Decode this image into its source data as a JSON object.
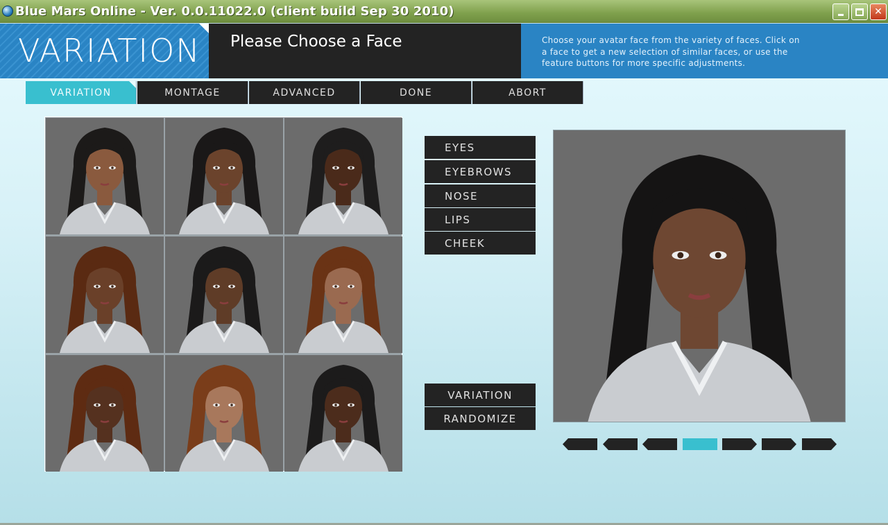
{
  "window": {
    "title": "Blue Mars Online - Ver. 0.0.11022.0 (client build Sep 30 2010)",
    "app_icon": "globe-icon",
    "controls": [
      "minimize-icon",
      "maximize-icon",
      "close-icon"
    ]
  },
  "header": {
    "brand": "VARIATION",
    "heading": "Please Choose a Face",
    "description": "Choose your avatar face from the variety of faces.  Click on a face to get a new selection of similar faces, or use the feature buttons for more specific adjustments."
  },
  "tabs": [
    {
      "label": "VARIATION",
      "active": true
    },
    {
      "label": "MONTAGE",
      "active": false
    },
    {
      "label": "ADVANCED",
      "active": false
    },
    {
      "label": "DONE",
      "active": false
    },
    {
      "label": "ABORT",
      "active": false
    }
  ],
  "features": [
    "EYES",
    "EYEBROWS",
    "NOSE",
    "LIPS",
    "CHEEK"
  ],
  "actions": [
    "VARIATION",
    "RANDOMIZE"
  ],
  "faces": [
    {
      "skin": "#8a5a3e",
      "hair": "#1c1a19"
    },
    {
      "skin": "#6b432c",
      "hair": "#1a1818"
    },
    {
      "skin": "#4a2a1a",
      "hair": "#1e1d1d"
    },
    {
      "skin": "#6a4029",
      "hair": "#5a2a12"
    },
    {
      "skin": "#5f3c27",
      "hair": "#1b1a1a"
    },
    {
      "skin": "#9a6a50",
      "hair": "#6a3315"
    },
    {
      "skin": "#55311f",
      "hair": "#5e2b12"
    },
    {
      "skin": "#a8785c",
      "hair": "#7a3d1a"
    },
    {
      "skin": "#4c2c1c",
      "hair": "#1c1b1b"
    }
  ],
  "preview": {
    "skin": "#6e4732",
    "hair": "#151414"
  },
  "colors": {
    "accent": "#39bfcf",
    "header_blue": "#2a84c4",
    "button_dark": "#232323"
  },
  "pager": {
    "pages": 7,
    "active_index": 3,
    "icons": [
      "arrow-left-icon",
      "arrow-left-icon",
      "arrow-left-icon",
      "page-indicator",
      "arrow-right-icon",
      "arrow-right-icon",
      "arrow-right-icon"
    ]
  }
}
